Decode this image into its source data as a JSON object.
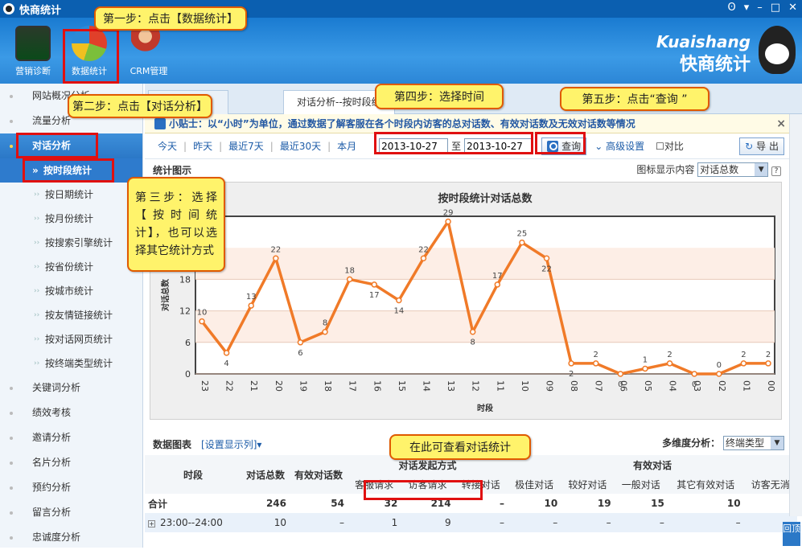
{
  "window": {
    "title": "快商统计"
  },
  "topbar": {
    "buttons": [
      {
        "label": "营销诊断"
      },
      {
        "label": "数据统计"
      },
      {
        "label": "CRM管理"
      }
    ],
    "brand_en": "Kuaishang",
    "brand_cn": "快商统计"
  },
  "sidebar": {
    "items": [
      {
        "label": "网站概况分析"
      },
      {
        "label": "流量分析"
      },
      {
        "label": "对话分析"
      },
      {
        "label": "按时段统计"
      },
      {
        "label": "按日期统计"
      },
      {
        "label": "按月份统计"
      },
      {
        "label": "按搜索引擎统计"
      },
      {
        "label": "按省份统计"
      },
      {
        "label": "按城市统计"
      },
      {
        "label": "按友情链接统计"
      },
      {
        "label": "按对话网页统计"
      },
      {
        "label": "按终端类型统计"
      },
      {
        "label": "关键词分析"
      },
      {
        "label": "绩效考核"
      },
      {
        "label": "邀请分析"
      },
      {
        "label": "名片分析"
      },
      {
        "label": "预约分析"
      },
      {
        "label": "留言分析"
      },
      {
        "label": "忠诚度分析"
      }
    ]
  },
  "tabs": [
    {
      "label": "对话分析--按时段统"
    }
  ],
  "tip": {
    "text": "小贴士：以“小时”为单位，通过数据了解客服在各个时段内访客的总对话数、有效对话数及无效对话数等情况"
  },
  "toolbar": {
    "today": "今天",
    "yesterday": "昨天",
    "last7": "最近7天",
    "last30": "最近30天",
    "month": "本月",
    "date_from": "2013-10-27",
    "to": "至",
    "date_to": "2013-10-27",
    "query": "查询",
    "advanced": "高级设置",
    "compare": "对比",
    "export": "导 出"
  },
  "chart_section": {
    "title": "统计图示",
    "display_label": "图标显示内容",
    "display_value": "对话总数"
  },
  "chart_data": {
    "type": "line",
    "title": "按时段统计对话总数",
    "xlabel": "时段",
    "ylabel": "对话总数",
    "categories": [
      "23",
      "22",
      "21",
      "20",
      "19",
      "18",
      "17",
      "16",
      "15",
      "14",
      "13",
      "12",
      "11",
      "10",
      "09",
      "08",
      "07",
      "06",
      "05",
      "04",
      "03",
      "02",
      "01",
      "00"
    ],
    "values": [
      10,
      4,
      13,
      22,
      6,
      8,
      18,
      17,
      14,
      22,
      29,
      8,
      17,
      25,
      22,
      2,
      2,
      0,
      1,
      2,
      0,
      0,
      2,
      2
    ],
    "yticks": [
      0,
      6,
      12,
      18
    ],
    "ylim": [
      0,
      30
    ],
    "grid": true,
    "line_color": "#f07a28"
  },
  "table_section": {
    "title": "数据图表",
    "settings": "[设置显示列]",
    "multi_label": "多维度分析：",
    "multi_value": "终端类型",
    "headers": {
      "period": "时段",
      "total": "对话总数",
      "valid": "有效对话数",
      "origin": "对话发起方式",
      "cs_req": "客服请求",
      "visitor_req": "访客请求",
      "transfer": "转接对话",
      "valid_group": "有效对话",
      "best": "极佳对话",
      "good": "较好对话",
      "normal": "一般对话",
      "other": "其它有效对话",
      "visitor_no": "访客无消"
    },
    "rows": [
      {
        "period": "合计",
        "total": "246",
        "valid": "54",
        "cs_req": "32",
        "visitor_req": "214",
        "transfer": "–",
        "best": "10",
        "good": "19",
        "normal": "15",
        "other": "10",
        "visitor_no": ""
      },
      {
        "period": "23:00--24:00",
        "total": "10",
        "valid": "–",
        "cs_req": "1",
        "visitor_req": "9",
        "transfer": "–",
        "best": "–",
        "good": "–",
        "normal": "–",
        "other": "–",
        "visitor_no": ""
      }
    ]
  },
  "annotations": {
    "step1": "第一步：点击【数据统计】",
    "step2": "第二步：点击【对话分析】",
    "step3": "第三步：选择【按时间统计】，也可以选择其它统计方式",
    "step4": "第四步：选择时间",
    "step5": "第五步：点击“查询 ”",
    "view": "在此可查看对话统计"
  },
  "backtop": "回顶"
}
